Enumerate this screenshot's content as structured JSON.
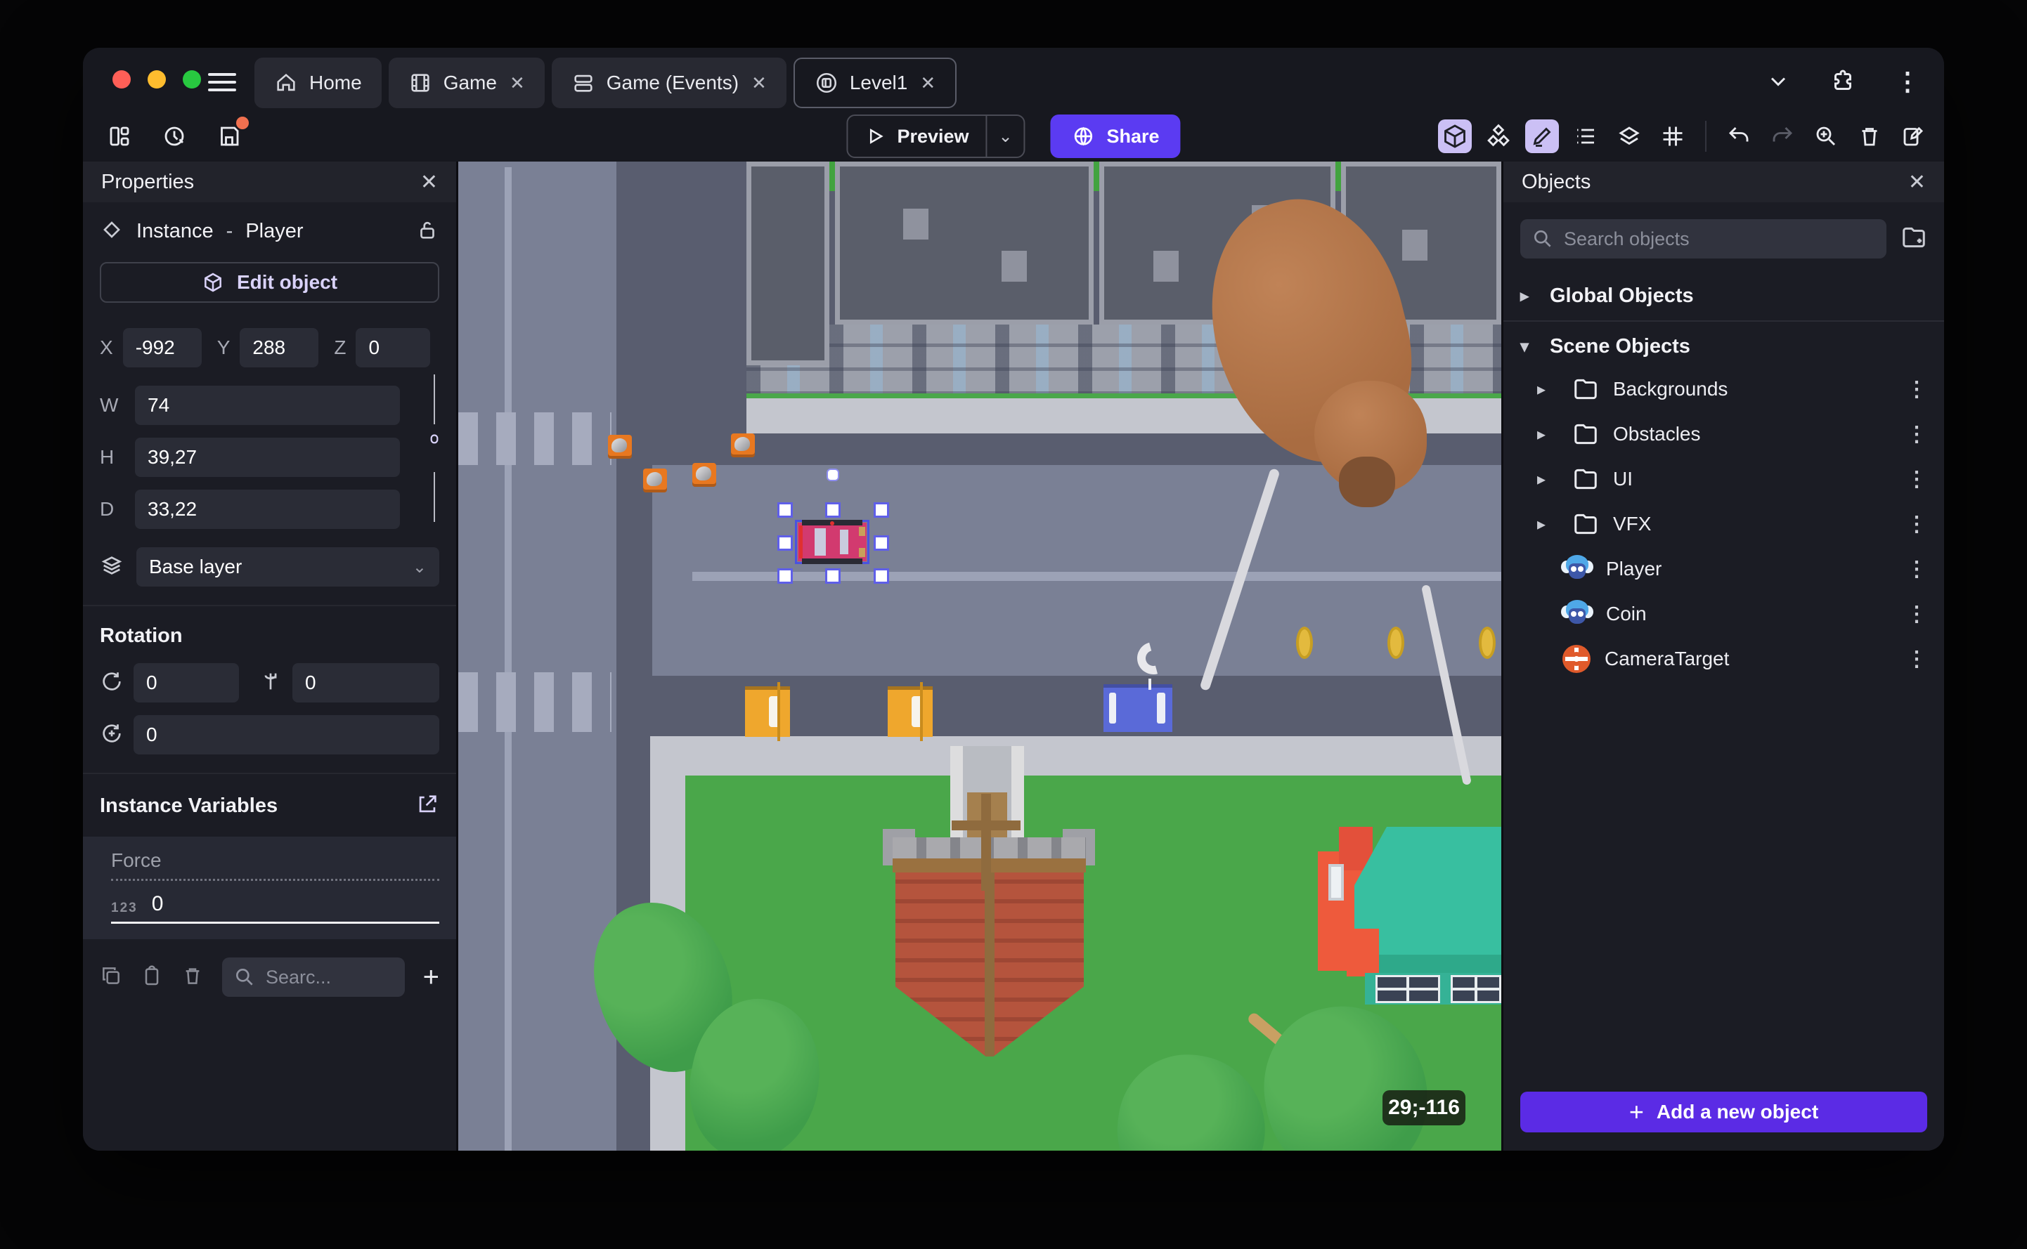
{
  "window_title": "Level1",
  "glyphs": {
    "close": "✕",
    "kebab": "⋮",
    "caret_right": "▸",
    "caret_down": "▾",
    "plus": "+",
    "chevron_down": "⌄",
    "minus": "-"
  },
  "colors": {
    "accent": "#5B3BF2",
    "add_button": "#5B2BE5",
    "active_pill": "#CBC0F5",
    "save_dot": "#F0704F",
    "traffic_red": "#FF5F57",
    "traffic_yellow": "#FEBC2E",
    "traffic_green": "#28C840",
    "grass": "#4AA74A",
    "road_light": "#7A8095",
    "road_dark": "#595D6F",
    "brick": "#B5543D",
    "teal_roof": "#38BFA0"
  },
  "titlebar": {
    "tabs": [
      {
        "label": "Home",
        "icon": "home-icon",
        "closable": false
      },
      {
        "label": "Game",
        "icon": "film-icon",
        "closable": true
      },
      {
        "label": "Game (Events)",
        "icon": "events-icon",
        "closable": true
      },
      {
        "label": "Level1",
        "icon": "scene-icon",
        "closable": true,
        "active": true
      }
    ]
  },
  "toolbar": {
    "preview_label": "Preview",
    "share_label": "Share"
  },
  "properties": {
    "title": "Properties",
    "instance_label": "Instance",
    "separator": "-",
    "object_name": "Player",
    "edit_object_label": "Edit object",
    "x_label": "X",
    "x_value": "-992",
    "y_label": "Y",
    "y_value": "288",
    "z_label": "Z",
    "z_value": "0",
    "w_label": "W",
    "w_value": "74",
    "h_label": "H",
    "h_value": "39,27",
    "d_label": "D",
    "d_value": "33,22",
    "layer_value": "Base layer",
    "rotation_title": "Rotation",
    "rot_x_value": "0",
    "rot_y_value": "0",
    "rot_z_value": "0",
    "variables_title": "Instance Variables",
    "variable_name": "Force",
    "variable_type_badge": "123",
    "variable_value": "0",
    "variables_search_placeholder": "Searc..."
  },
  "objects": {
    "title": "Objects",
    "search_placeholder": "Search objects",
    "global_group_label": "Global Objects",
    "scene_group_label": "Scene Objects",
    "items": [
      {
        "label": "Backgrounds",
        "icon": "folder-icon"
      },
      {
        "label": "Obstacles",
        "icon": "folder-icon"
      },
      {
        "label": "UI",
        "icon": "folder-icon"
      },
      {
        "label": "VFX",
        "icon": "folder-icon"
      },
      {
        "label": "Player",
        "icon": "monkey-icon"
      },
      {
        "label": "Coin",
        "icon": "monkey-icon"
      },
      {
        "label": "CameraTarget",
        "icon": "target-icon"
      }
    ],
    "add_button_label": "Add a new object"
  },
  "canvas": {
    "coords_badge": "29;-116",
    "selected_object": "Player"
  }
}
